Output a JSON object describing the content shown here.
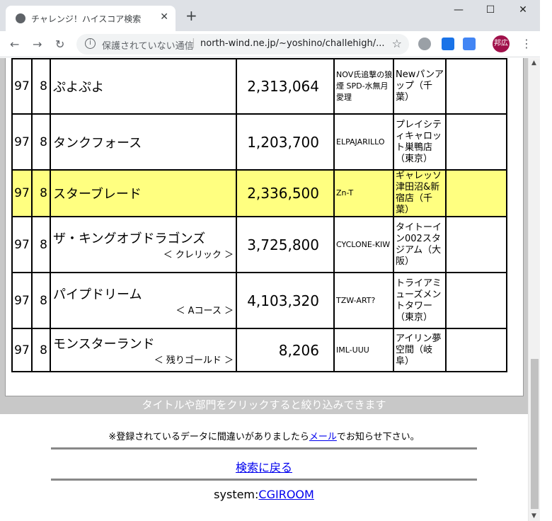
{
  "browser": {
    "tab_title": "チャレンジ！ハイスコア検索",
    "new_tab": "+",
    "minimize": "—",
    "maximize": "☐",
    "close": "✕",
    "security_text": "保護されていない通信",
    "url": "north-wind.ne.jp/~yoshino/challehigh/...",
    "avatar_text": "邦広",
    "accent": "#a0104a"
  },
  "table": {
    "rows": [
      {
        "a": "97",
        "b": "8",
        "title": "ぷよぷよ",
        "sub": "",
        "score": "2,313,064",
        "player": "NOV氏追撃の狼煙 SPD-水無月愛理",
        "place": "Newパンアップ（千葉）",
        "highlight": false
      },
      {
        "a": "97",
        "b": "8",
        "title": "タンクフォース",
        "sub": "",
        "score": "1,203,700",
        "player": "ELPAJARILLO",
        "place": "プレイシティキャロット巣鴨店（東京）",
        "highlight": false
      },
      {
        "a": "97",
        "b": "8",
        "title": "スターブレード",
        "sub": "",
        "score": "2,336,500",
        "player": "Zn-T",
        "place": "ギャレッソ津田沼&新宿店（千葉）",
        "highlight": true
      },
      {
        "a": "97",
        "b": "8",
        "title": "ザ・キングオブドラゴンズ",
        "sub": "＜ クレリック ＞",
        "score": "3,725,800",
        "player": "CYCLONE-KIW",
        "place": "タイトーイン002スタジアム（大阪）",
        "highlight": false
      },
      {
        "a": "97",
        "b": "8",
        "title": "パイプドリーム",
        "sub": "＜ Aコース ＞",
        "score": "4,103,320",
        "player": "TZW-ART?",
        "place": "トライアミューズメントタワー（東京）",
        "highlight": false
      },
      {
        "a": "97",
        "b": "8",
        "title": "モンスターランド",
        "sub": "＜ 残りゴールド ＞",
        "score": "8,206",
        "player": "IML-UUU",
        "place": "アイリン夢空間（岐阜）",
        "highlight": false
      }
    ],
    "highlight_color": "#ffff80"
  },
  "hint": "タイトルや部門をクリックすると絞り込みできます",
  "notice": {
    "before": "※登録されているデータに間違いがありましたら",
    "link": "メール",
    "after": "でお知らせ下さい。"
  },
  "back_link": "検索に戻る",
  "system": {
    "label": "system:",
    "link": "CGIROOM"
  }
}
